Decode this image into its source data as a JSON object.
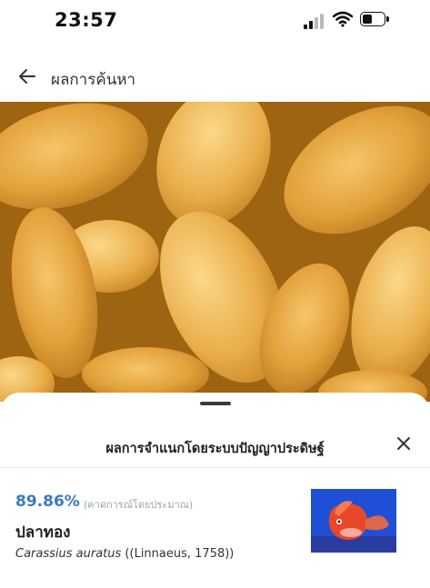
{
  "status_bar": {
    "time": "23:57",
    "icons": [
      "signal-icon",
      "wifi-icon",
      "battery-icon"
    ]
  },
  "header": {
    "title": "ผลการค้นหา",
    "back_icon": "back-arrow-icon"
  },
  "photo": {
    "subject": "fried dough sticks",
    "dominant_color": "#d89a2e"
  },
  "sheet": {
    "title": "ผลการจำแนกโดยระบบปัญญาประดิษฐ์",
    "close_icon": "close-icon",
    "result": {
      "confidence": "89.86%",
      "confidence_note": "(คาดการณ์โดยประมาณ)",
      "common_name": "ปลาทอง",
      "scientific_name": "Carassius auratus",
      "authority": " ((Linnaeus, 1758))"
    }
  },
  "colors": {
    "accent": "#3a78c2",
    "thumb_bg": "#1f4fd6",
    "fish": "#e8482a"
  }
}
